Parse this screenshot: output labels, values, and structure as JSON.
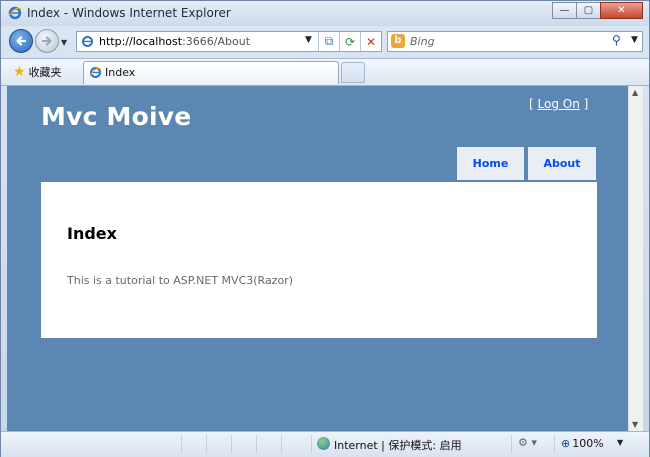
{
  "window": {
    "title": "Index - Windows Internet Explorer",
    "buttons": {
      "minimize": "—",
      "maximize": "▢",
      "close": "✕"
    }
  },
  "nav": {
    "back_icon": "back-arrow-icon",
    "forward_icon": "forward-arrow-icon",
    "url_host": "http://localhost",
    "url_rest": ":3666/About",
    "address_dropdown": "▼",
    "refresh": "⟳",
    "stop": "✕",
    "compat": "⧉"
  },
  "search": {
    "placeholder": "Bing",
    "logo": "b",
    "search_icon": "⚲",
    "dropdown": "▼"
  },
  "favorites": {
    "label": "收藏夹"
  },
  "tabs": [
    {
      "label": "Index"
    }
  ],
  "site": {
    "title": "Mvc Moive",
    "login_open": "[ ",
    "login_link": "Log On",
    "login_close": " ]",
    "menu": [
      {
        "label": "Home"
      },
      {
        "label": "About"
      }
    ],
    "heading": "Index",
    "body": "This is a tutorial to ASP.NET MVC3(Razor)"
  },
  "status": {
    "zone": "Internet | 保护模式: 启用",
    "zoom": "100%",
    "zoom_dropdown": "▼",
    "security_icon": "security-settings-icon"
  },
  "colors": {
    "page_bg": "#5c87b2",
    "menu_bg": "#e8eef4",
    "menu_text": "#034af3",
    "content_bg": "#ffffff"
  }
}
